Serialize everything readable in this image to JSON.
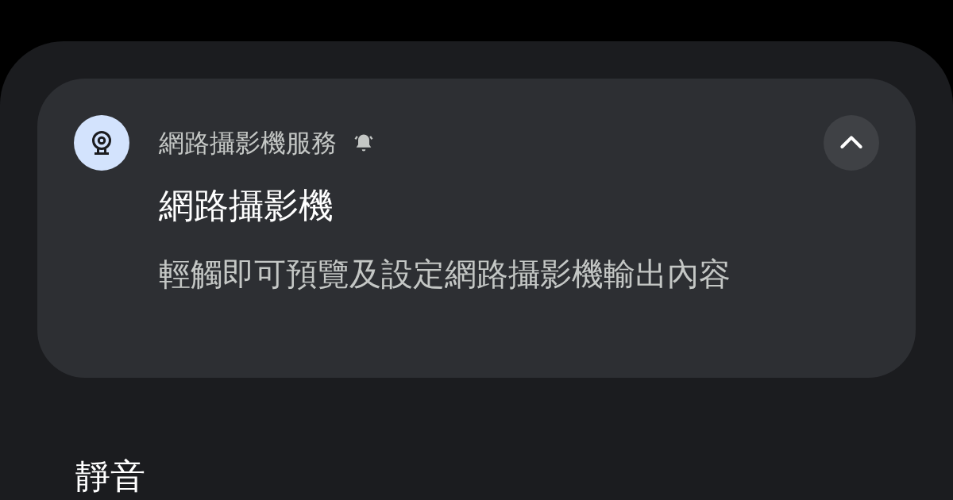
{
  "notification": {
    "app_name": "網路攝影機服務",
    "title": "網路攝影機",
    "body": "輕觸即可預覽及設定網路攝影機輸出內容",
    "expanded": true
  },
  "section_header": "靜音"
}
